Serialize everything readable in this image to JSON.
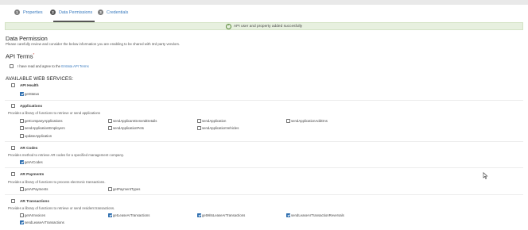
{
  "steps": [
    {
      "num": "1",
      "label": "Properties"
    },
    {
      "num": "2",
      "label": "Data Permissions"
    },
    {
      "num": "3",
      "label": "Credentials"
    }
  ],
  "success_message": "API user and property added succesfully",
  "data_permission": {
    "title": "Data Permission",
    "subtitle": "Please carefully review and consider the below information you are enabling to be shared with 3rd party vendors."
  },
  "api_terms": {
    "title": "API Terms",
    "required_mark": "*",
    "agree_prefix": "I have read and agree to the",
    "agree_link": "Entrata API Terms"
  },
  "services_title": "AVAILABLE WEB SERVICES:",
  "sections": {
    "health": {
      "title": "API Health",
      "items": [
        {
          "label": "getStatus",
          "checked": true
        }
      ]
    },
    "applications": {
      "title": "Applications",
      "desc": "Provides a library of functions to retrieve or send applications",
      "items": [
        {
          "label": "getCompanyApplications",
          "checked": false
        },
        {
          "label": "sendApplicantGeneralDetails",
          "checked": false
        },
        {
          "label": "sendApplication",
          "checked": false
        },
        {
          "label": "sendApplicationAddOns",
          "checked": false
        },
        {
          "label": "sendApplicationEmployers",
          "checked": false
        },
        {
          "label": "sendApplicationPets",
          "checked": false
        },
        {
          "label": "sendApplicationVehicles",
          "checked": false
        },
        {
          "label": "updateApplication",
          "checked": false
        }
      ]
    },
    "arcodes": {
      "title": "AR Codes",
      "desc": "Provides method to retrieve AR codes for a specified management company.",
      "items": [
        {
          "label": "getArCodes",
          "checked": true
        }
      ]
    },
    "arpayments": {
      "title": "AR Payments",
      "desc": "Provides a library of functions to process electronic transactions.",
      "items": [
        {
          "label": "getArPayments",
          "checked": false
        },
        {
          "label": "getPaymentTypes",
          "checked": false
        }
      ]
    },
    "artransactions": {
      "title": "AR Transactions",
      "desc": "Provides a library of functions to retrieve or send resident transactions.",
      "items": [
        {
          "label": "getArInvoices",
          "checked": false
        },
        {
          "label": "getLeaseArTransactions",
          "checked": true
        },
        {
          "label": "getMitsLeaseArTransactions",
          "checked": true
        },
        {
          "label": "sendLeaseArTransactionReversals",
          "checked": true
        },
        {
          "label": "sendLeaseArTransactions",
          "checked": true
        }
      ]
    }
  },
  "colors": {
    "link": "#3a7bbf",
    "checkbox_checked": "#2f6fb0",
    "success_bg": "#e7f0df"
  }
}
